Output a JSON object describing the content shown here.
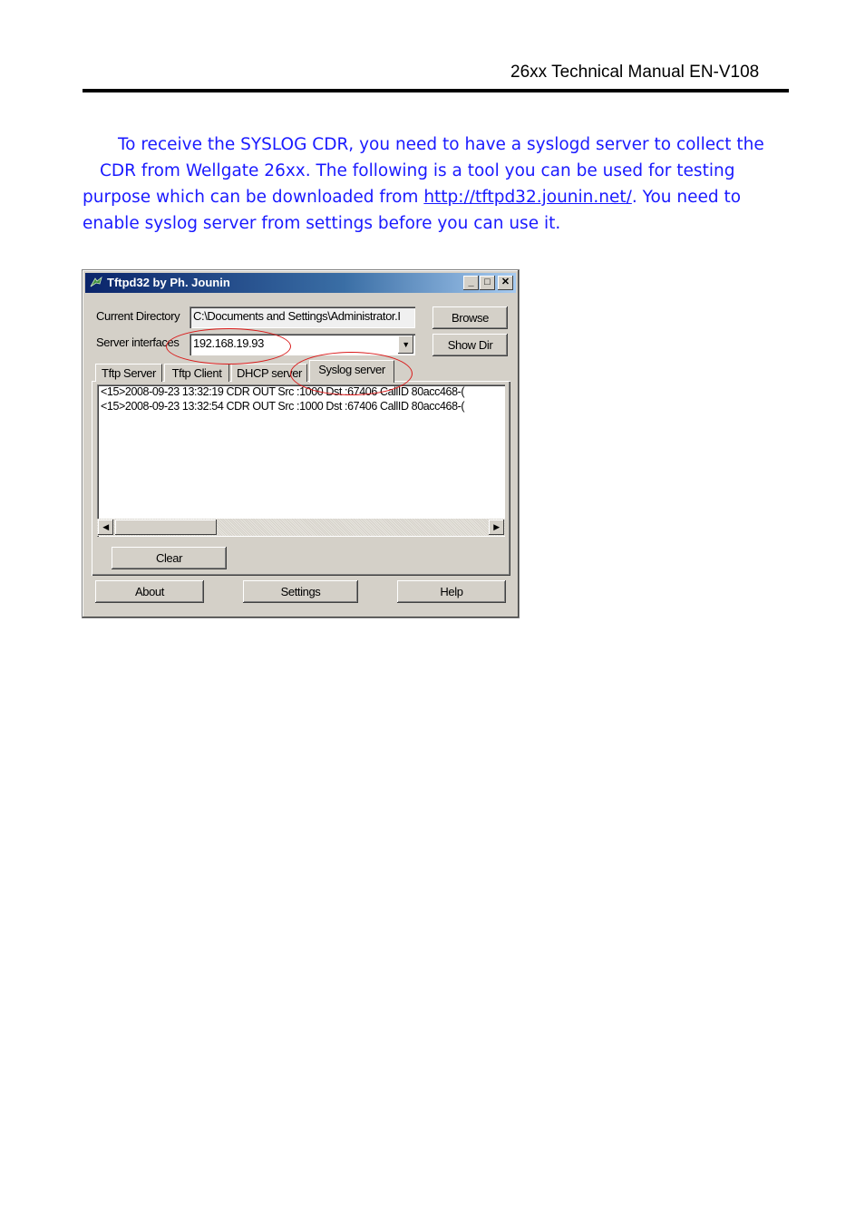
{
  "header": {
    "title": "26xx Technical Manual EN-V108"
  },
  "intro": {
    "line1": "To receive the SYSLOG CDR, you need to have a syslogd server to collect the",
    "line2": "CDR from Wellgate 26xx. The following is a tool you can be used for testing",
    "line3_prefix": "purpose which can be downloaded from ",
    "link": "http://tftpd32.jounin.net/",
    "line3_suffix": ".   You need to",
    "line4": "enable syslog server from settings before you can use it."
  },
  "window": {
    "title": "Tftpd32 by Ph. Jounin",
    "current_directory_label": "Current Directory",
    "current_directory_value": "C:\\Documents and Settings\\Administrator.I",
    "browse_label": "Browse",
    "server_interfaces_label": "Server interfaces",
    "server_interface_value": "192.168.19.93",
    "show_dir_label": "Show Dir",
    "tabs": [
      {
        "label": "Tftp Server"
      },
      {
        "label": "Tftp Client"
      },
      {
        "label": "DHCP server"
      },
      {
        "label": "Syslog server"
      }
    ],
    "active_tab": "Syslog server",
    "log_entries": [
      "<15>2008-09-23 13:32:19 CDR  OUT Src :1000 Dst :67406 CallID 80acc468-(",
      "<15>2008-09-23 13:32:54 CDR  OUT Src :1000 Dst :67406 CallID 80acc468-("
    ],
    "clear_label": "Clear",
    "about_label": "About",
    "settings_label": "Settings",
    "help_label": "Help",
    "minimize_glyph": "_",
    "maximize_glyph": "□",
    "close_glyph": "✕",
    "dropdown_glyph": "▼",
    "scroll_left_glyph": "◀",
    "scroll_right_glyph": "▶"
  },
  "colors": {
    "intro_text": "#1a1aff",
    "annotation_circle": "#d91a1a"
  }
}
